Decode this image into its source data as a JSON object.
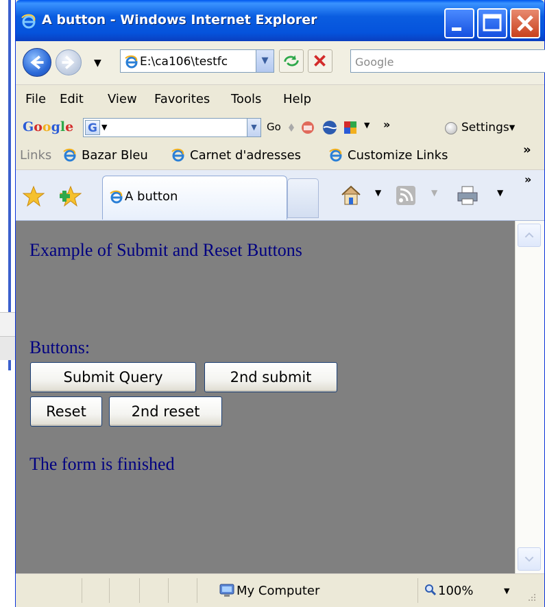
{
  "window": {
    "title": "A button - Windows Internet Explorer",
    "controls": {
      "minimize": "minimize",
      "maximize": "maximize",
      "close": "close"
    }
  },
  "nav": {
    "address": "E:\\ca106\\testfc",
    "search_placeholder": "Google"
  },
  "menu": [
    "File",
    "Edit",
    "View",
    "Favorites",
    "Tools",
    "Help"
  ],
  "google_toolbar": {
    "logo": "Google",
    "go": "Go",
    "overflow": "»",
    "settings": "Settings▾"
  },
  "links_bar": {
    "label": "Links",
    "items": [
      "Bazar Bleu",
      "Carnet d'adresses",
      "Customize Links"
    ],
    "overflow": "»"
  },
  "tabs": {
    "active_tab": "A button",
    "overflow": "»"
  },
  "page": {
    "heading": "Example of Submit and Reset Buttons",
    "buttons_label": "Buttons:",
    "submit_button": "Submit Query",
    "second_submit": "2nd submit",
    "reset_button": "Reset",
    "second_reset": "2nd reset",
    "footer_text": "The form is finished",
    "background_color": "#808080",
    "text_color": "#000080"
  },
  "status": {
    "zone": "My Computer",
    "zoom": "100%"
  }
}
